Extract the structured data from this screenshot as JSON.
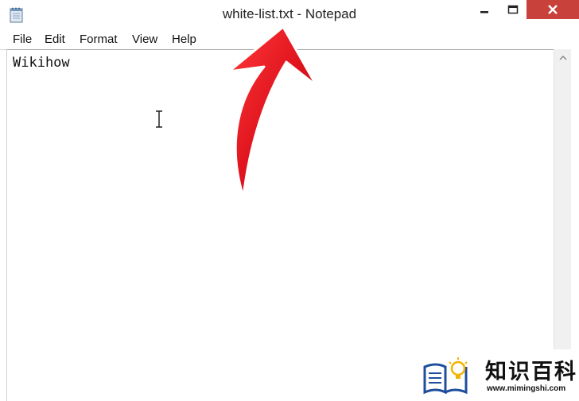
{
  "window": {
    "title_file": "white-list.txt",
    "title_separator": " - ",
    "title_app": "Notepad"
  },
  "icons": {
    "app": "notepad-icon",
    "minimize": "minimize-icon",
    "maximize": "maximize-icon",
    "close": "close-icon",
    "scroll_up": "chevron-up-icon",
    "cursor": "text-cursor-icon",
    "annotation": "red-arrow-annotation",
    "watermark_logo": "book-lightbulb-icon"
  },
  "menu": {
    "items": [
      {
        "label": "File"
      },
      {
        "label": "Edit"
      },
      {
        "label": "Format"
      },
      {
        "label": "View"
      },
      {
        "label": "Help"
      }
    ]
  },
  "editor": {
    "content": "Wikihow"
  },
  "watermark": {
    "title": "知识百科",
    "url": "www.mimingshi.com"
  },
  "colors": {
    "close_button": "#c9413b",
    "annotation_arrow": "#e0141e",
    "watermark_blue": "#1f4e9c",
    "watermark_yellow": "#f2b400"
  }
}
